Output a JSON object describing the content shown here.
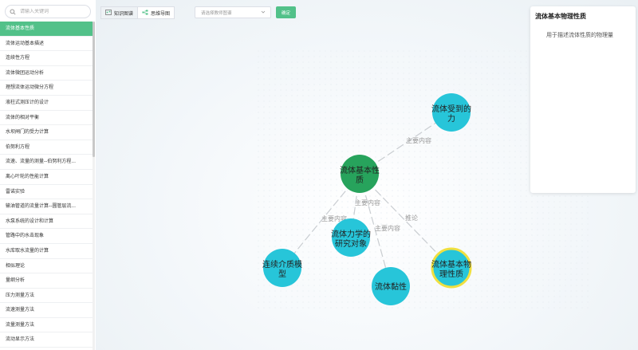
{
  "search": {
    "placeholder": "请输入关键词"
  },
  "sidebar": {
    "items": [
      "流体基本性质",
      "流体运动基本描述",
      "连续性方程",
      "流体微团运动分析",
      "理想流体运动微分方程",
      "液柱式测压计的设计",
      "流体的相对平衡",
      "水坝闸门的受力计算",
      "伯努利方程",
      "流速、流量的测量--伯努利方程...",
      "离心叶轮的性能计算",
      "雷诺实验",
      "输油管道的流量计算--圆管层流...",
      "水泵系统的设计和计算",
      "管路中的水击现象",
      "水库取水流量的计算",
      "相似理论",
      "量纲分析",
      "压力测量方法",
      "流速测量方法",
      "流量测量方法",
      "流动显示方法"
    ]
  },
  "toolbar": {
    "tab_knowledge": "知识图谱",
    "tab_mindmap": "思维导图",
    "select_placeholder": "请选择教师图谱",
    "confirm": "确定"
  },
  "graph": {
    "nodes": [
      {
        "id": "center",
        "line1": "流体基本性",
        "line2": "质",
        "color": "#27a35c"
      },
      {
        "id": "force",
        "line1": "流体受到的",
        "line2": "力",
        "color": "#27c5d9"
      },
      {
        "id": "research",
        "line1": "流体力学的",
        "line2": "研究对象",
        "color": "#27c5d9"
      },
      {
        "id": "continuum",
        "line1": "连续介质模",
        "line2": "型",
        "color": "#27c5d9"
      },
      {
        "id": "viscosity",
        "line1": "流体黏性",
        "line2": "",
        "color": "#27c5d9"
      },
      {
        "id": "physprop",
        "line1": "流体基本物",
        "line2": "理性质",
        "color": "#27c5d9",
        "highlight": "#f0e040"
      }
    ],
    "edges": [
      {
        "from": "center",
        "to": "force",
        "label": "主要内容"
      },
      {
        "from": "center",
        "to": "continuum",
        "label": "主要内容"
      },
      {
        "from": "center",
        "to": "research",
        "label": "主要内容"
      },
      {
        "from": "center",
        "to": "viscosity",
        "label": "主要内容"
      },
      {
        "from": "center",
        "to": "physprop",
        "label": "推论"
      }
    ]
  },
  "panel": {
    "title": "流体基本物理性质",
    "description": "用于描述流体性质的物理量"
  }
}
